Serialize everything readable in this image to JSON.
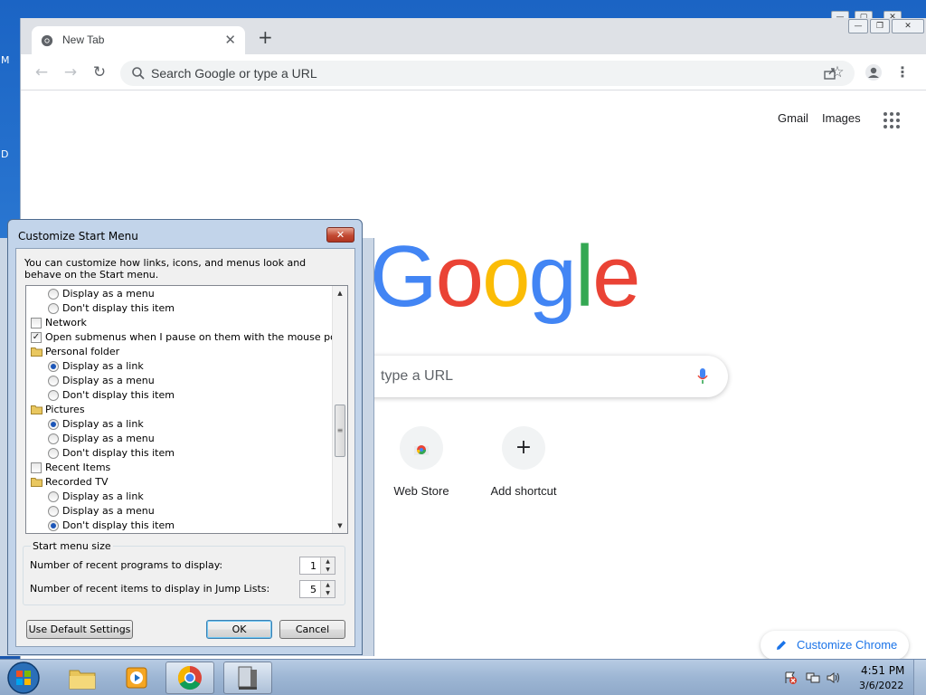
{
  "desktop": {
    "letters": [
      "M",
      "D"
    ]
  },
  "chrome": {
    "tab": {
      "title": "New Tab",
      "close": "✕"
    },
    "new_tab": "+",
    "omnibox_placeholder": "Search Google or type a URL",
    "header_links": {
      "gmail": "Gmail",
      "images": "Images"
    },
    "logo": [
      "G",
      "o",
      "o",
      "g",
      "l",
      "e"
    ],
    "logo_colors": [
      "#4285f4",
      "#ea4335",
      "#fbbc05",
      "#4285f4",
      "#34a853",
      "#ea4335"
    ],
    "search_placeholder": "type a URL",
    "shortcuts": [
      {
        "label": "Web Store"
      },
      {
        "label": "Add shortcut",
        "icon": "+"
      }
    ],
    "customize": "Customize Chrome"
  },
  "dialog": {
    "title": "Customize Start Menu",
    "close": "✕",
    "description": "You can customize how links, icons, and menus look and behave on the Start menu.",
    "items": [
      {
        "type": "radio",
        "label": "Display as a menu",
        "checked": false
      },
      {
        "type": "radio",
        "label": "Don't display this item",
        "checked": false
      },
      {
        "type": "checkbox",
        "label": "Network",
        "checked": false
      },
      {
        "type": "checkbox",
        "label": "Open submenus when I pause on them with the mouse pointer",
        "checked": true
      },
      {
        "type": "folder",
        "label": "Personal folder"
      },
      {
        "type": "radio",
        "label": "Display as a link",
        "checked": true
      },
      {
        "type": "radio",
        "label": "Display as a menu",
        "checked": false
      },
      {
        "type": "radio",
        "label": "Don't display this item",
        "checked": false
      },
      {
        "type": "folder",
        "label": "Pictures"
      },
      {
        "type": "radio",
        "label": "Display as a link",
        "checked": true
      },
      {
        "type": "radio",
        "label": "Display as a menu",
        "checked": false
      },
      {
        "type": "radio",
        "label": "Don't display this item",
        "checked": false
      },
      {
        "type": "checkbox",
        "label": "Recent Items",
        "checked": false
      },
      {
        "type": "folder",
        "label": "Recorded TV"
      },
      {
        "type": "radio",
        "label": "Display as a link",
        "checked": false
      },
      {
        "type": "radio",
        "label": "Display as a menu",
        "checked": false
      },
      {
        "type": "radio",
        "label": "Don't display this item",
        "checked": true
      }
    ],
    "size_group": {
      "label": "Start menu size",
      "recent_programs_label": "Number of recent programs to display:",
      "recent_programs_value": "1",
      "jump_list_label": "Number of recent items to display in Jump Lists:",
      "jump_list_value": "5"
    },
    "buttons": {
      "defaults": "Use Default Settings",
      "ok": "OK",
      "cancel": "Cancel"
    }
  },
  "taskbar": {
    "time": "4:51 PM",
    "date": "3/6/2022"
  }
}
